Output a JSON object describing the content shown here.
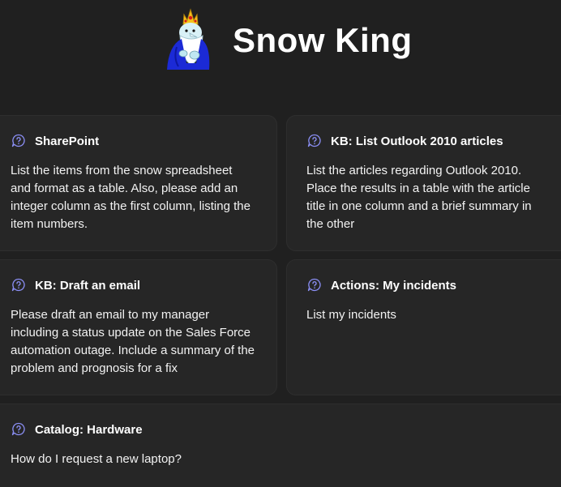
{
  "app": {
    "title": "Snow King",
    "avatar_icon": "ice-king-avatar"
  },
  "cards": [
    {
      "title": "SharePoint",
      "icon": "chat-question-icon",
      "text": "List the items from the snow spreadsheet and format as a table. Also, please add an integer column as the first column, listing the item numbers."
    },
    {
      "title": "KB: List Outlook 2010 articles",
      "icon": "chat-question-icon",
      "text": "List the articles regarding Outlook 2010. Place the results in a table with the article title in one column and a brief summary in the other"
    },
    {
      "title": "KB: Draft an email",
      "icon": "chat-question-icon",
      "text": "Please draft an email to my manager including a status update on the Sales Force automation outage. Include a summary of the problem and prognosis for a fix"
    },
    {
      "title": "Actions: My incidents",
      "icon": "chat-question-icon",
      "text": "List my incidents"
    },
    {
      "title": "Catalog: Hardware",
      "icon": "chat-question-icon",
      "text": "How do I request a new laptop?"
    }
  ],
  "colors": {
    "background": "#202020",
    "card": "#262626",
    "icon_accent": "#8b8ff5"
  }
}
